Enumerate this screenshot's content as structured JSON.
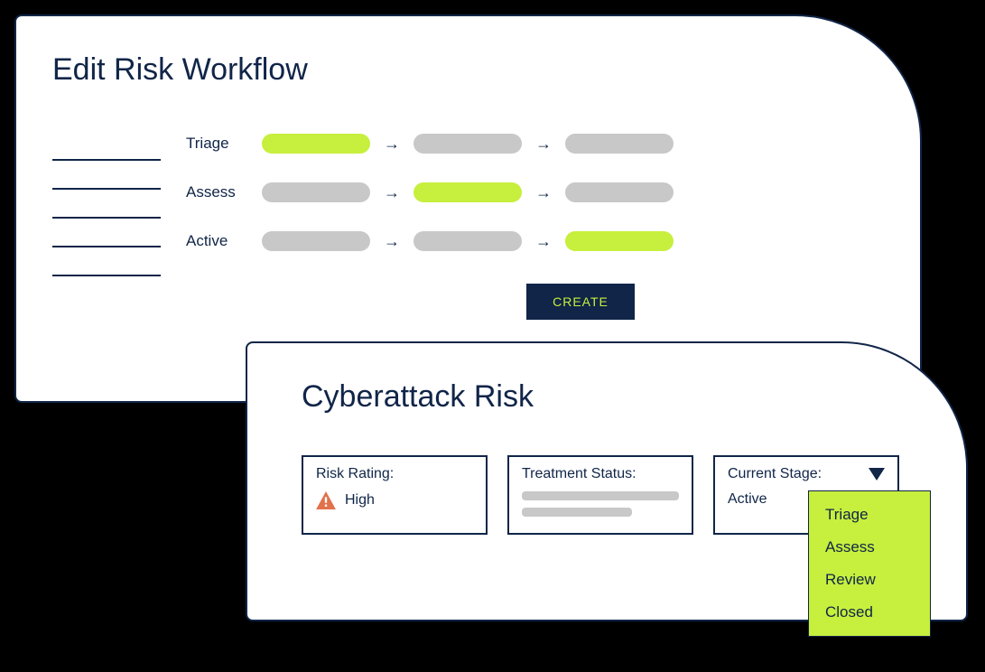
{
  "workflow_panel": {
    "title": "Edit Risk Workflow",
    "rows": [
      {
        "label": "Triage",
        "active_index": 0
      },
      {
        "label": "Assess",
        "active_index": 1
      },
      {
        "label": "Active",
        "active_index": 2
      }
    ],
    "create_button": "CREATE"
  },
  "risk_panel": {
    "title": "Cyberattack Risk",
    "risk_rating": {
      "label": "Risk Rating:",
      "value": "High"
    },
    "treatment_status": {
      "label": "Treatment Status:"
    },
    "current_stage": {
      "label": "Current Stage:",
      "value": "Active",
      "options": [
        "Triage",
        "Assess",
        "Review",
        "Closed"
      ]
    }
  },
  "colors": {
    "navy": "#102548",
    "lime": "#c7ef3d",
    "gray": "#c8c8c8",
    "warn": "#e2714c"
  }
}
